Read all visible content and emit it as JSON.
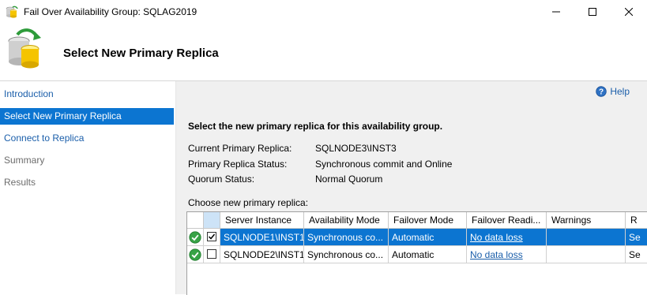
{
  "window": {
    "title": "Fail Over Availability Group: SQLAG2019",
    "icon": "database-failover-icon"
  },
  "header": {
    "title": "Select New Primary Replica",
    "icon": "database-failover-large-icon"
  },
  "sidebar": {
    "items": [
      {
        "label": "Introduction",
        "state": "link"
      },
      {
        "label": "Select New Primary Replica",
        "state": "selected"
      },
      {
        "label": "Connect to Replica",
        "state": "link"
      },
      {
        "label": "Summary",
        "state": "disabled"
      },
      {
        "label": "Results",
        "state": "disabled"
      }
    ]
  },
  "help": {
    "label": "Help",
    "icon": "help-icon"
  },
  "main": {
    "intro": "Select the new primary replica for this availability group.",
    "fields": [
      {
        "label": "Current Primary Replica:",
        "value": "SQLNODE3\\INST3"
      },
      {
        "label": "Primary Replica Status:",
        "value": "Synchronous commit and Online"
      },
      {
        "label": "Quorum Status:",
        "value": "Normal Quorum"
      }
    ],
    "choose_label": "Choose new primary replica:"
  },
  "grid": {
    "columns": [
      "",
      "",
      "Server Instance",
      "Availability Mode",
      "Failover Mode",
      "Failover Readi...",
      "Warnings",
      "R"
    ],
    "rows": [
      {
        "selected": true,
        "checked": true,
        "status_icon": "ok-check-icon",
        "server": "SQLNODE1\\INST1",
        "mode": "Synchronous co...",
        "failover": "Automatic",
        "readiness": "No data loss",
        "warnings": "",
        "extra": "Se"
      },
      {
        "selected": false,
        "checked": false,
        "status_icon": "ok-check-icon",
        "server": "SQLNODE2\\INST1",
        "mode": "Synchronous co...",
        "failover": "Automatic",
        "readiness": "No data loss",
        "warnings": "",
        "extra": "Se"
      }
    ]
  },
  "colors": {
    "selection": "#0c75d1",
    "link": "#1a5eaa",
    "content_bg": "#f0f0f0"
  }
}
